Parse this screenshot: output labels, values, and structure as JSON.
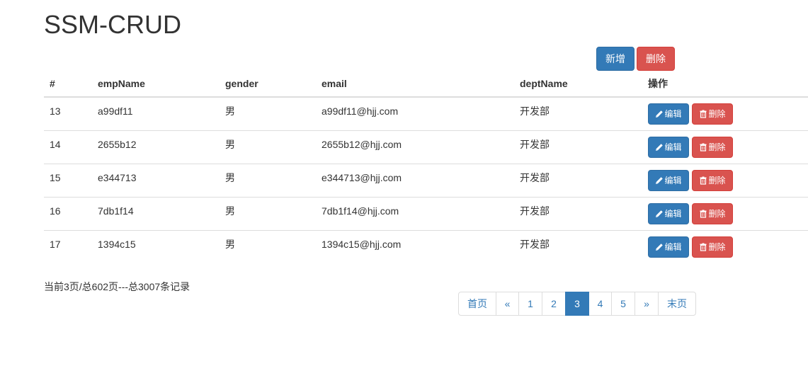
{
  "title": "SSM-CRUD",
  "toolbar": {
    "add_label": "新增",
    "delete_label": "删除"
  },
  "table": {
    "headers": [
      "#",
      "empName",
      "gender",
      "email",
      "deptName",
      "操作"
    ],
    "rows": [
      {
        "id": "13",
        "empName": "a99df11",
        "gender": "男",
        "email": "a99df11@hjj.com",
        "deptName": "开发部"
      },
      {
        "id": "14",
        "empName": "2655b12",
        "gender": "男",
        "email": "2655b12@hjj.com",
        "deptName": "开发部"
      },
      {
        "id": "15",
        "empName": "e344713",
        "gender": "男",
        "email": "e344713@hjj.com",
        "deptName": "开发部"
      },
      {
        "id": "16",
        "empName": "7db1f14",
        "gender": "男",
        "email": "7db1f14@hjj.com",
        "deptName": "开发部"
      },
      {
        "id": "17",
        "empName": "1394c15",
        "gender": "男",
        "email": "1394c15@hjj.com",
        "deptName": "开发部"
      }
    ],
    "edit_label": "编辑",
    "delete_label": "删除",
    "edit_icon": "pencil-icon",
    "delete_icon": "trash-icon"
  },
  "page_info": "当前3页/总602页---总3007条记录",
  "pagination": {
    "first": "首页",
    "prev": "«",
    "pages": [
      "1",
      "2",
      "3",
      "4",
      "5"
    ],
    "active_page": "3",
    "next": "»",
    "last": "末页"
  },
  "colors": {
    "primary": "#337ab7",
    "danger": "#d9534f",
    "border": "#dddddd",
    "text": "#333333"
  }
}
